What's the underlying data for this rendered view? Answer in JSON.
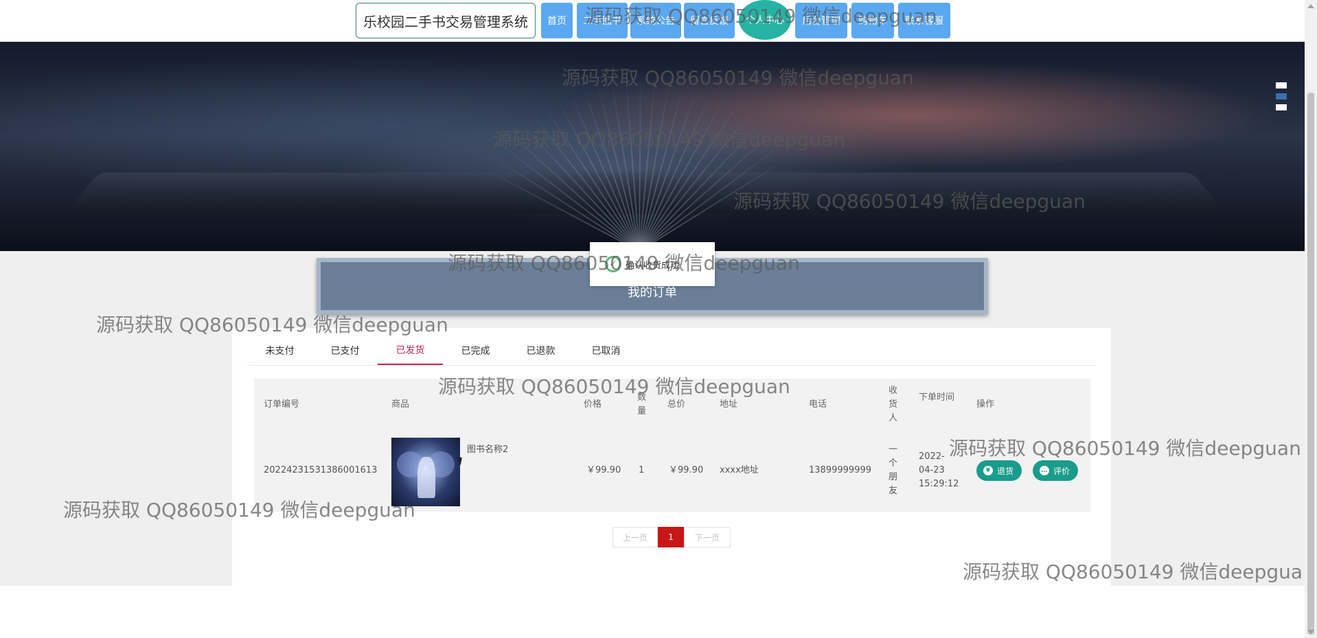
{
  "header": {
    "brand": "乐校园二手书交易管理系统",
    "nav": [
      "首页",
      "二手图书",
      "系统公告",
      "留言反馈",
      "个人中心",
      "后台管理",
      "购物车",
      "联系客服"
    ],
    "active_nav": "个人中心"
  },
  "toast": {
    "message": "确认收货成功"
  },
  "section": {
    "title": "我的订单"
  },
  "tabs": [
    "未支付",
    "已支付",
    "已发货",
    "已完成",
    "已退款",
    "已取消"
  ],
  "active_tab": "已发货",
  "table": {
    "headers": [
      "订单编号",
      "商品",
      "价格",
      "数量",
      "总价",
      "地址",
      "电话",
      "收货人",
      "下单时间",
      "操作"
    ],
    "rows": [
      {
        "order_no": "20224231531386001613",
        "product": "图书名称2",
        "price": "￥99.90",
        "qty": "1",
        "total": "￥99.90",
        "address": "xxxx地址",
        "phone": "13899999999",
        "receiver": "一个朋友",
        "time": "2022-04-23 15:29:12",
        "actions": [
          "退货",
          "评价"
        ]
      }
    ]
  },
  "pagination": {
    "prev": "上一页",
    "current": "1",
    "next": "下一页"
  },
  "watermark": "源码获取 QQ86050149 微信deepguan",
  "colors": {
    "accent": "#1a9c8b",
    "nav": "#5aa8f0",
    "active_tab": "#c7254e",
    "page_current": "#c81616"
  }
}
